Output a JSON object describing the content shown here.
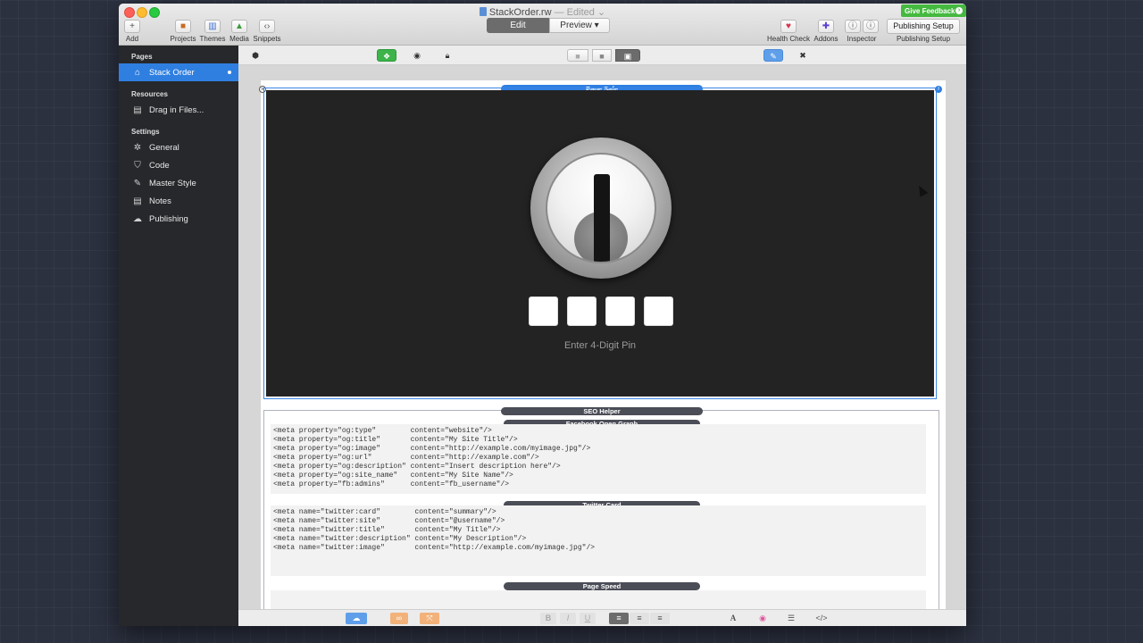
{
  "window": {
    "title": "StackOrder.rw",
    "edited": "— Edited",
    "feedback_label": "Give Feedback"
  },
  "toolbar": {
    "add": "Add",
    "projects": "Projects",
    "themes": "Themes",
    "media": "Media",
    "snippets": "Snippets",
    "edit_tab": "Edit",
    "preview_tab": "Preview",
    "health_check": "Health Check",
    "addons": "Addons",
    "inspector": "Inspector",
    "publishing_setup_button": "Publishing Setup",
    "publishing_setup_label": "Publishing Setup"
  },
  "sidebar": {
    "pages_header": "Pages",
    "pages": [
      {
        "label": "Stack Order",
        "icon": "home-icon"
      }
    ],
    "resources_header": "Resources",
    "resources": [
      {
        "label": "Drag in Files...",
        "icon": "file-icon"
      }
    ],
    "settings_header": "Settings",
    "settings": [
      {
        "label": "General",
        "icon": "gear-icon"
      },
      {
        "label": "Code",
        "icon": "code-icon"
      },
      {
        "label": "Master Style",
        "icon": "wand-icon"
      },
      {
        "label": "Notes",
        "icon": "notes-icon"
      },
      {
        "label": "Publishing",
        "icon": "cloud-icon"
      }
    ]
  },
  "canvas": {
    "page_safe_label": "Page Safe",
    "pin_label": "Enter 4-Digit Pin",
    "seo_helper_label": "SEO Helper",
    "facebook_label": "Facebook Open Graph",
    "facebook_lines": [
      "<meta property=\"og:type\"        content=\"website\"/>",
      "<meta property=\"og:title\"       content=\"My Site Title\"/>",
      "<meta property=\"og:image\"       content=\"http://example.com/myimage.jpg\"/>",
      "<meta property=\"og:url\"         content=\"http://example.com\"/>",
      "<meta property=\"og:description\" content=\"Insert description here\"/>",
      "<meta property=\"og:site_name\"   content=\"My Site Name\"/>",
      "<meta property=\"fb:admins\"      content=\"fb_username\"/>"
    ],
    "twitter_label": "Twitter Card",
    "twitter_lines": [
      "<meta name=\"twitter:card\"        content=\"summary\"/>",
      "<meta name=\"twitter:site\"        content=\"@username\"/>",
      "<meta name=\"twitter:title\"       content=\"My Title\"/>",
      "<meta name=\"twitter:description\" content=\"My Description\"/>",
      "<meta name=\"twitter:image\"       content=\"http://example.com/myimage.jpg\"/>"
    ],
    "page_speed_label": "Page Speed"
  },
  "format_bar": {
    "bold": "B",
    "italic": "I",
    "underline": "U",
    "font": "A",
    "code": "</>"
  },
  "colors": {
    "accent": "#2f7fe0",
    "sidebar_bg": "#26282b",
    "feedback_green": "#45b93f"
  }
}
